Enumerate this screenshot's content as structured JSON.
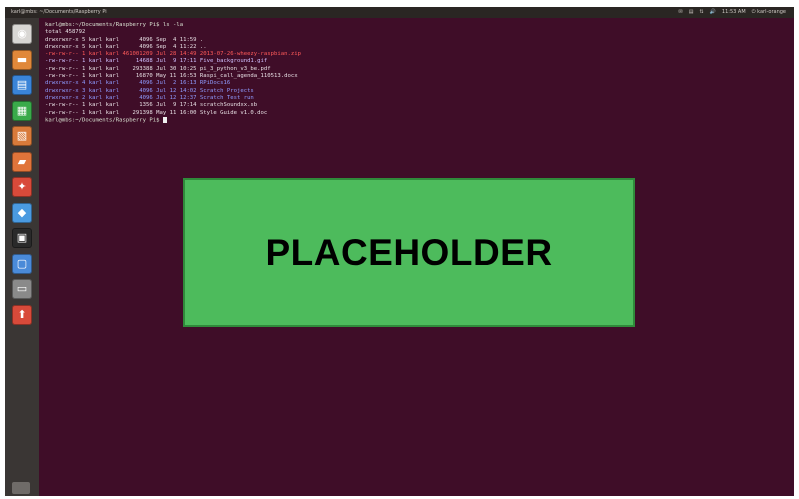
{
  "window": {
    "title": "karl@mbs: ~/Documents/Raspberry Pi",
    "indicators": [
      "✉",
      "▤",
      "⇅",
      "🔊",
      "11:53 AM",
      "⏻ karl-orange"
    ]
  },
  "launcher": {
    "items": [
      {
        "name": "dash-icon",
        "glyph": "◉",
        "color": "#d8d6d3"
      },
      {
        "name": "files-icon",
        "glyph": "▬",
        "color": "#e0883a"
      },
      {
        "name": "writer-icon",
        "glyph": "▤",
        "color": "#3a84d8"
      },
      {
        "name": "calc-icon",
        "glyph": "▦",
        "color": "#3aaa4a"
      },
      {
        "name": "impress-icon",
        "glyph": "▧",
        "color": "#d87a3a"
      },
      {
        "name": "software-center-icon",
        "glyph": "▰",
        "color": "#e0743a"
      },
      {
        "name": "settings-icon",
        "glyph": "✦",
        "color": "#d84a3a"
      },
      {
        "name": "browser-icon",
        "glyph": "◆",
        "color": "#4a9ae0"
      },
      {
        "name": "terminal-icon",
        "glyph": "▣",
        "color": "#2a2a2a"
      },
      {
        "name": "workspace-icon",
        "glyph": "▢",
        "color": "#4a8ad8"
      },
      {
        "name": "disks-icon",
        "glyph": "▭",
        "color": "#8a8a8a"
      },
      {
        "name": "update-icon",
        "glyph": "⬆",
        "color": "#d84a3a"
      }
    ]
  },
  "terminal": {
    "lines": [
      {
        "text": "karl@mbs:~/Documents/Raspberry Pi$ ls -la",
        "cls": "prompt"
      },
      {
        "text": "total 458792",
        "cls": ""
      },
      {
        "text": "drwxrwxr-x 5 karl karl      4096 Sep  4 11:59 .",
        "cls": ""
      },
      {
        "text": "drwxrwxr-x 5 karl karl      4096 Sep  4 11:22 ..",
        "cls": ""
      },
      {
        "text": "-rw-rw-r-- 1 karl karl 461001209 Jul 28 14:49 2013-07-26-wheezy-raspbian.zip",
        "cls": "zip"
      },
      {
        "text": "-rw-rw-r-- 1 karl karl     14688 Jul  9 17:11 Five_background1.gif",
        "cls": "gif"
      },
      {
        "text": "-rw-rw-r-- 1 karl karl    293388 Jul 30 10:25 pi_3_python_v3_be.pdf",
        "cls": ""
      },
      {
        "text": "-rw-rw-r-- 1 karl karl     16870 May 11 16:53 Raspi_call_agenda_110513.docx",
        "cls": ""
      },
      {
        "text": "drwxrwxr-x 4 karl karl      4096 Jul  2 16:13 RPiDocs16",
        "cls": "dir"
      },
      {
        "text": "drwxrwxr-x 3 karl karl      4096 Jul 12 14:02 Scratch Projects",
        "cls": "dir"
      },
      {
        "text": "drwxrwxr-x 2 karl karl      4096 Jul 12 12:37 Scratch Test run",
        "cls": "dir"
      },
      {
        "text": "-rw-rw-r-- 1 karl karl      1356 Jul  9 17:14 scratchSoundxx.sb",
        "cls": ""
      },
      {
        "text": "-rw-rw-r-- 1 karl karl    291398 May 11 16:00 Style Guide v1.0.doc",
        "cls": ""
      },
      {
        "text": "karl@mbs:~/Documents/Raspberry Pi$ ",
        "cls": "prompt",
        "cursor": true
      }
    ]
  },
  "placeholder": {
    "label": "PLACEHOLDER"
  }
}
